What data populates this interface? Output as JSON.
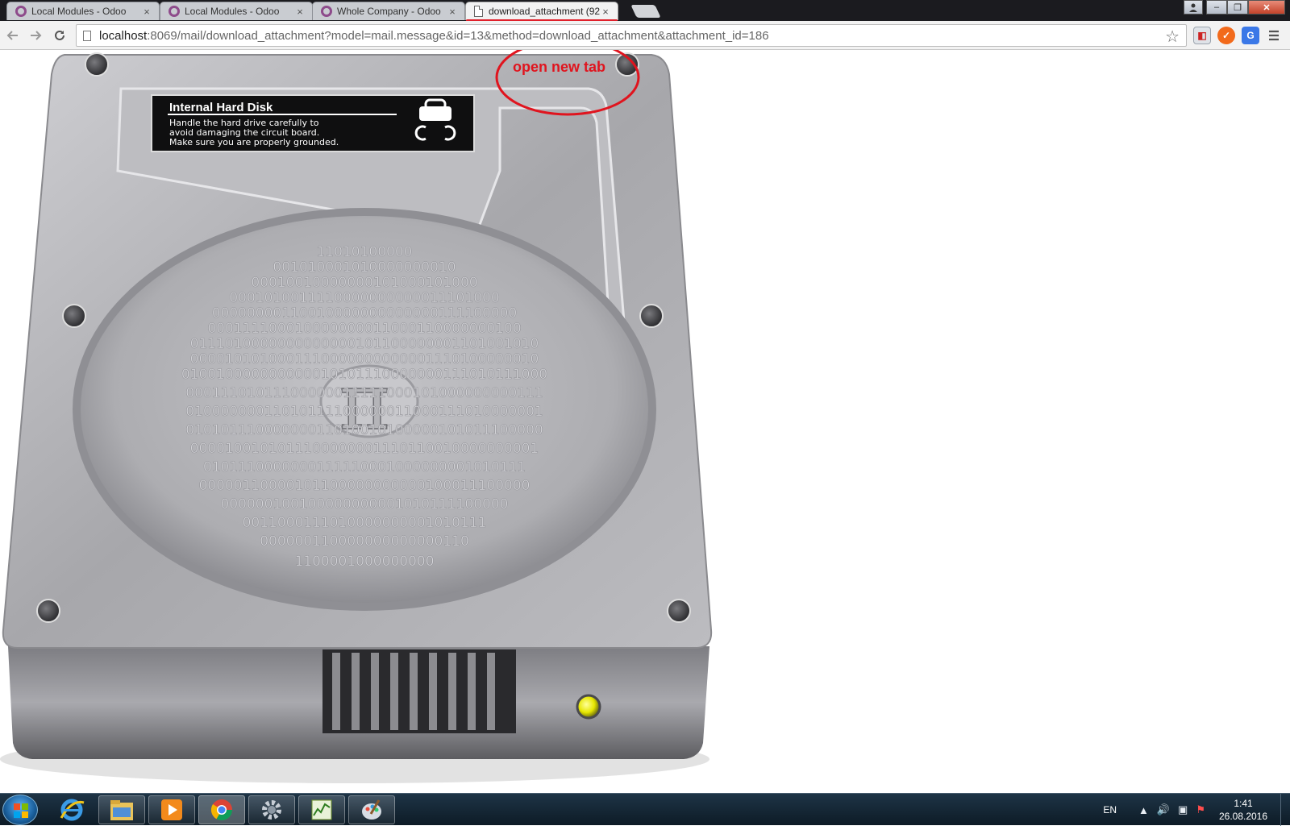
{
  "browser": {
    "tabs": [
      {
        "title": "Local Modules - Odoo",
        "close": "×"
      },
      {
        "title": "Local Modules - Odoo",
        "close": "×"
      },
      {
        "title": "Whole Company - Odoo",
        "close": "×"
      },
      {
        "title": "download_attachment (92",
        "close": "×"
      }
    ],
    "address": {
      "host": "localhost",
      "path": ":8069/mail/download_attachment?model=mail.message&id=13&method=download_attachment&attachment_id=186"
    },
    "window_controls": {
      "minimize": "‒",
      "maximize": "❐",
      "close": "✕"
    }
  },
  "content": {
    "annotation": "open new tab",
    "disk_label": {
      "heading": "Internal Hard Disk",
      "lines": [
        "Handle the hard drive carefully to",
        "avoid damaging the circuit board.",
        "Make sure you are properly grounded."
      ]
    },
    "pi_symbol": "π",
    "binary_rows": [
      "11010100000",
      "001010001010000000010",
      "00010010000000101000101000",
      "0001010011110000000000011101000",
      "00000000110010000000000000111100000",
      "000111100010000000011000110000000100",
      "0111010000000000000101100000001101001010",
      "0000101010001110000000000001110100000010",
      "010010000000000010101110000000111010111000",
      "00011101011100000011111000101000000000111",
      "01000000011010111100000011000111010000001",
      "01010111000000011010010100000101011100000",
      "0000100101011100000001110110010000000001",
      "0101110000000111110001000000001010111",
      "00000110000101100000000000100011100000",
      "000000100100000000001010111100000",
      "0011000111010000000001010111",
      "000000110000000000000110",
      "1100001000000000"
    ]
  },
  "taskbar": {
    "language": "EN",
    "time": "1:41",
    "date": "26.08.2016",
    "apps": [
      "internet-explorer",
      "file-explorer",
      "media-player",
      "chrome",
      "settings",
      "task-manager",
      "paint"
    ]
  }
}
